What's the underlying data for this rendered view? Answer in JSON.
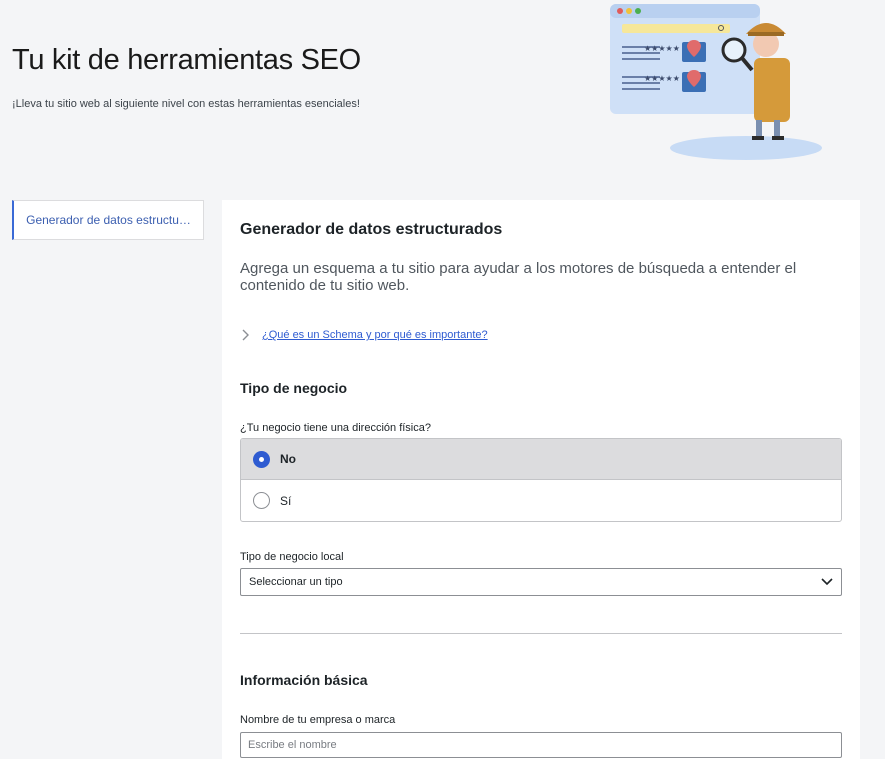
{
  "hero": {
    "title": "Tu kit de herramientas SEO",
    "subtitle": "¡Lleva tu sitio web al siguiente nivel con estas herramientas esenciales!",
    "illustration_icon": "detective-magnifier-illustration"
  },
  "sidebar": {
    "items": [
      {
        "label": "Generador de datos estructu…",
        "active": true
      }
    ]
  },
  "panel": {
    "title": "Generador de datos estructurados",
    "description": "Agrega un esquema a tu sitio para ayudar a los motores de búsqueda a entender el contenido de tu sitio web.",
    "faq_link": "¿Qué es un Schema y por qué es importante?",
    "business_type": {
      "section_title": "Tipo de negocio",
      "question": "¿Tu negocio tiene una dirección física?",
      "options": [
        {
          "label": "No",
          "selected": true
        },
        {
          "label": "Sí",
          "selected": false
        }
      ]
    },
    "local_type": {
      "label": "Tipo de negocio local",
      "selected": "Seleccionar un tipo"
    },
    "basic_info": {
      "section_title": "Información básica",
      "name_label": "Nombre de tu empresa o marca",
      "name_placeholder": "Escribe el nombre",
      "name_value": ""
    }
  },
  "colors": {
    "accent": "#2e5bd1",
    "page_bg": "#f4f5f7",
    "panel_bg": "#ffffff"
  }
}
